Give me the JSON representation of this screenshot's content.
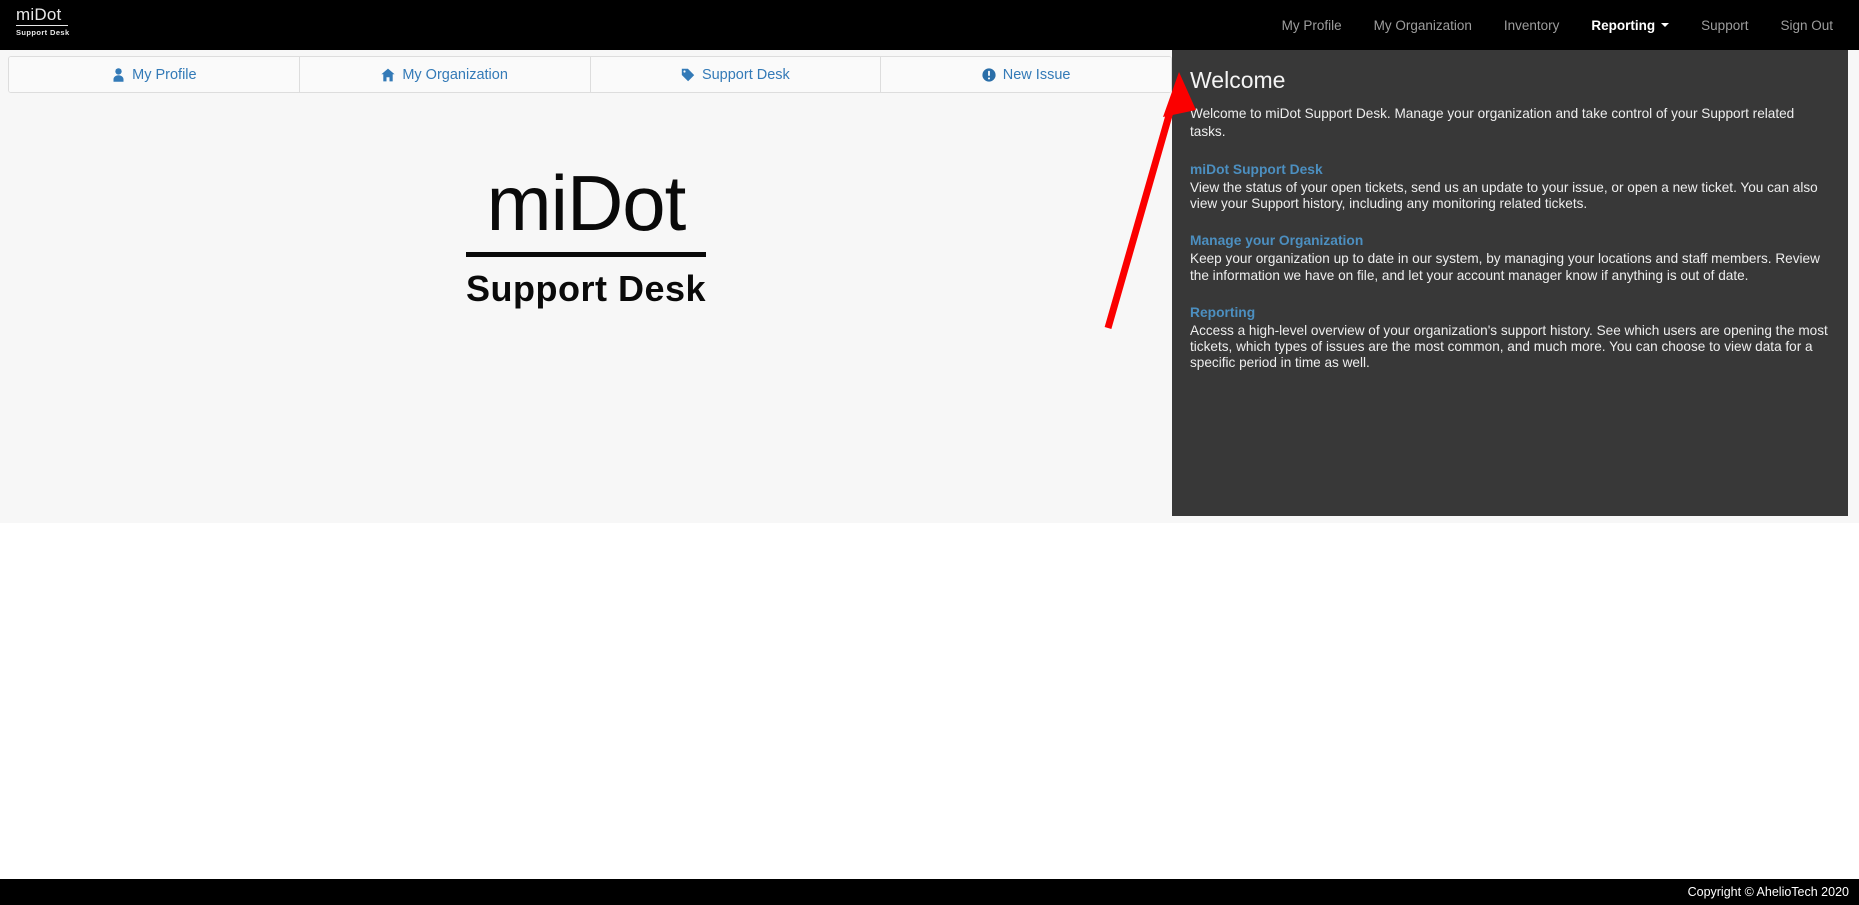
{
  "navbar": {
    "brand": {
      "main": "miDot",
      "sub": "Support Desk"
    },
    "links": [
      {
        "label": "My Profile",
        "active": false
      },
      {
        "label": "My Organization",
        "active": false
      },
      {
        "label": "Inventory",
        "active": false
      },
      {
        "label": "Reporting",
        "active": true,
        "has_caret": true
      },
      {
        "label": "Support",
        "active": false
      },
      {
        "label": "Sign Out",
        "active": false
      }
    ]
  },
  "tabs": [
    {
      "label": "My Profile",
      "icon": "user-icon"
    },
    {
      "label": "My Organization",
      "icon": "home-icon"
    },
    {
      "label": "Support Desk",
      "icon": "tag-icon"
    },
    {
      "label": "New Issue",
      "icon": "exclamation-circle-icon"
    }
  ],
  "logo": {
    "main": "miDot",
    "sub": "Support Desk"
  },
  "welcome": {
    "title": "Welcome",
    "lead": "Welcome to miDot Support Desk. Manage your organization and take control of your Support related tasks.",
    "sections": [
      {
        "title": "miDot Support Desk",
        "body": "View the status of your open tickets, send us an update to your issue, or open a new ticket. You can also view your Support history, including any monitoring related tickets."
      },
      {
        "title": "Manage your Organization",
        "body": "Keep your organization up to date in our system, by managing your locations and staff members. Review the information we have on file, and let your account manager know if anything is out of date."
      },
      {
        "title": "Reporting",
        "body": "Access a high-level overview of your organization's support history. See which users are opening the most tickets, which types of issues are the most common, and much more. You can choose to view data for a specific period in time as well."
      }
    ]
  },
  "footer": {
    "copyright": "Copyright © AhelioTech 2020"
  },
  "colors": {
    "navbar_bg": "#000000",
    "link_blue": "#337ab7",
    "panel_bg": "#383838",
    "panel_heading_blue": "#4c8fc0",
    "content_bg": "#f7f7f7",
    "annotation_red": "#fb0000"
  }
}
